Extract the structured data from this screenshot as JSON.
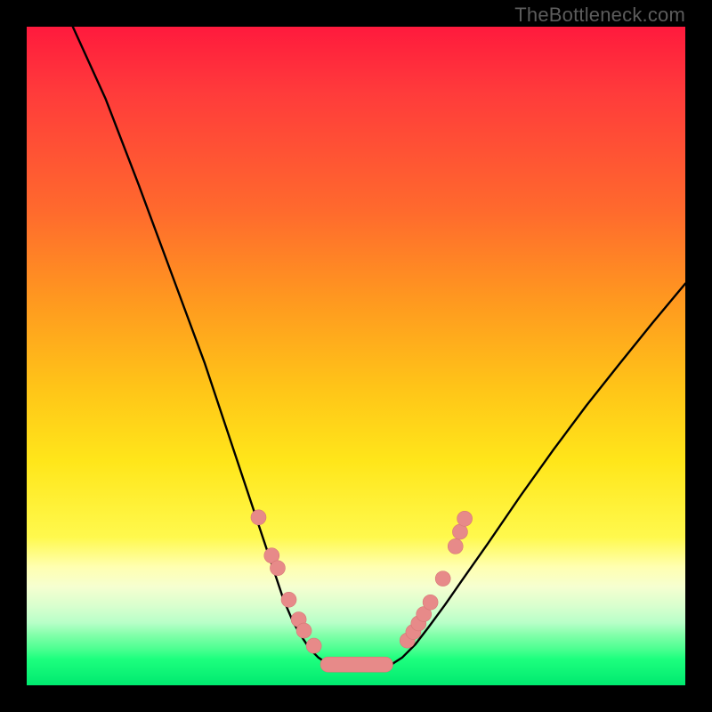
{
  "attribution": "TheBottleneck.com",
  "chart_data": {
    "type": "line",
    "title": "",
    "xlabel": "",
    "ylabel": "",
    "xlim": [
      0,
      100
    ],
    "ylim": [
      0,
      100
    ],
    "grid": false,
    "legend": false,
    "series": [
      {
        "name": "left-curve",
        "x": [
          7,
          12,
          17,
          22,
          27,
          30,
          33,
          35.5,
          37.5,
          39,
          40.5,
          42,
          43,
          44.3,
          45.2,
          46,
          46.8
        ],
        "y": [
          100,
          89,
          76,
          62.5,
          49,
          40,
          31,
          23.5,
          17.5,
          13,
          9.5,
          7,
          5.5,
          4.2,
          3.6,
          3.2,
          3.0
        ]
      },
      {
        "name": "floor",
        "x": [
          46.8,
          48,
          49.5,
          51,
          52.5,
          54,
          55.2
        ],
        "y": [
          3.0,
          2.9,
          2.85,
          2.85,
          2.9,
          2.95,
          3.05
        ]
      },
      {
        "name": "right-curve",
        "x": [
          55.2,
          57,
          59,
          61,
          63.5,
          66,
          70,
          75,
          80,
          85,
          90,
          95,
          100
        ],
        "y": [
          3.05,
          4.2,
          6.2,
          8.8,
          12.2,
          15.8,
          21.5,
          28.8,
          35.8,
          42.5,
          48.8,
          55,
          61
        ]
      }
    ],
    "markers": [
      {
        "name": "left-dots",
        "points": [
          {
            "x": 35.2,
            "y": 25.5
          },
          {
            "x": 37.2,
            "y": 19.7
          },
          {
            "x": 38.1,
            "y": 17.8
          },
          {
            "x": 39.8,
            "y": 13.0
          },
          {
            "x": 41.3,
            "y": 10.0
          },
          {
            "x": 42.1,
            "y": 8.3
          },
          {
            "x": 43.6,
            "y": 6.0
          }
        ]
      },
      {
        "name": "right-dots",
        "points": [
          {
            "x": 57.8,
            "y": 6.8
          },
          {
            "x": 58.7,
            "y": 8.1
          },
          {
            "x": 59.5,
            "y": 9.4
          },
          {
            "x": 60.3,
            "y": 10.8
          },
          {
            "x": 61.3,
            "y": 12.6
          },
          {
            "x": 63.2,
            "y": 16.2
          },
          {
            "x": 65.1,
            "y": 21.1
          },
          {
            "x": 65.8,
            "y": 23.3
          },
          {
            "x": 66.5,
            "y": 25.3
          }
        ]
      },
      {
        "name": "floor-pill",
        "rect": {
          "x0": 44.6,
          "y0": 2.0,
          "x1": 55.6,
          "y1": 4.3
        }
      }
    ],
    "colors": {
      "curve": "#000000",
      "marker_fill": "#e78a89",
      "marker_stroke": "#d77776"
    }
  }
}
